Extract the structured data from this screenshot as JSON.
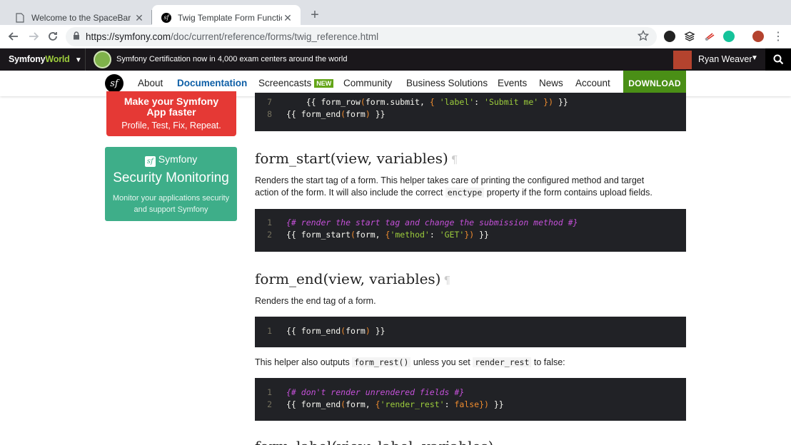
{
  "browser": {
    "tabs": [
      {
        "title": "Welcome to the SpaceBar",
        "active": false
      },
      {
        "title": "Twig Template Form Function a",
        "active": true
      }
    ],
    "url": {
      "host": "https://symfony.com",
      "path": "/doc/current/reference/forms/twig_reference.html"
    }
  },
  "sitebar": {
    "logo_main": "Symfony",
    "logo_world": "World",
    "announcement": "Symfony Certification now in 4,000 exam centers around the world",
    "user_name": "Ryan Weaver"
  },
  "nav": {
    "items": [
      "About",
      "Documentation",
      "Screencasts",
      "Community",
      "Business Solutions",
      "Events",
      "News",
      "Account"
    ],
    "new_badge": "NEW",
    "download": "DOWNLOAD"
  },
  "sidebar": {
    "ad_red": {
      "line1": "Make your Symfony",
      "line2": "App faster",
      "tagline": "Profile, Test, Fix, Repeat."
    },
    "ad_green": {
      "brand": "Symfony",
      "title": "Security Monitoring",
      "line1": "Monitor your applications security",
      "line2": "and support Symfony"
    }
  },
  "content": {
    "code0": {
      "ln7": "7",
      "ln8": "8"
    },
    "h_form_start": "form_start(view, variables)",
    "p_form_start_1": "Renders the start tag of a form. This helper takes care of printing the configured method and target",
    "p_form_start_2a": "action of the form. It will also include the correct ",
    "p_form_start_code": "enctype",
    "p_form_start_2b": " property if the form contains upload fields.",
    "code1": {
      "comment": "{# render the start tag and change the submission method #}"
    },
    "h_form_end": "form_end(view, variables)",
    "p_form_end": "Renders the end tag of a form.",
    "p_helper_a": "This helper also outputs ",
    "p_helper_code1": "form_rest()",
    "p_helper_b": " unless you set ",
    "p_helper_code2": "render_rest",
    "p_helper_c": " to false:",
    "code3": {
      "comment": "{# don't render unrendered fields #}"
    },
    "pilcrow": "¶",
    "cutoff_heading": "form_label(view, label, variables)"
  }
}
